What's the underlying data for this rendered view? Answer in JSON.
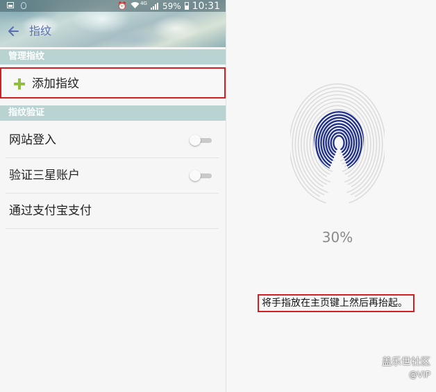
{
  "status_bar": {
    "network": "4G",
    "battery_percent": "59%",
    "time": "10:31",
    "icons": [
      "gallery-icon",
      "notification-icon",
      "alarm-icon",
      "wifi-icon",
      "signal-icon",
      "battery-icon"
    ]
  },
  "header": {
    "back_icon": "arrow-left-icon",
    "title": "指纹"
  },
  "sections": {
    "manage": {
      "title": "管理指纹",
      "add_label": "添加指纹"
    },
    "verify": {
      "title": "指纹验证",
      "items": [
        {
          "label": "网站登入",
          "toggle": "off"
        },
        {
          "label": "验证三星账户",
          "toggle": "off"
        },
        {
          "label": "通过支付宝支付"
        }
      ]
    }
  },
  "registration": {
    "progress_text": "30%",
    "progress_value": 0.3,
    "instruction": "将手指放在主页键上然后再抬起。"
  },
  "watermark": {
    "line1": "盖乐世社区",
    "line2": "@VIP"
  },
  "colors": {
    "section_header_bg": "#b9d3d3",
    "title_color": "#5a6fb2",
    "highlight_border": "#d22020",
    "plus_icon": "#8fbf3c",
    "fingerprint_fill": "#1e2f8a"
  }
}
